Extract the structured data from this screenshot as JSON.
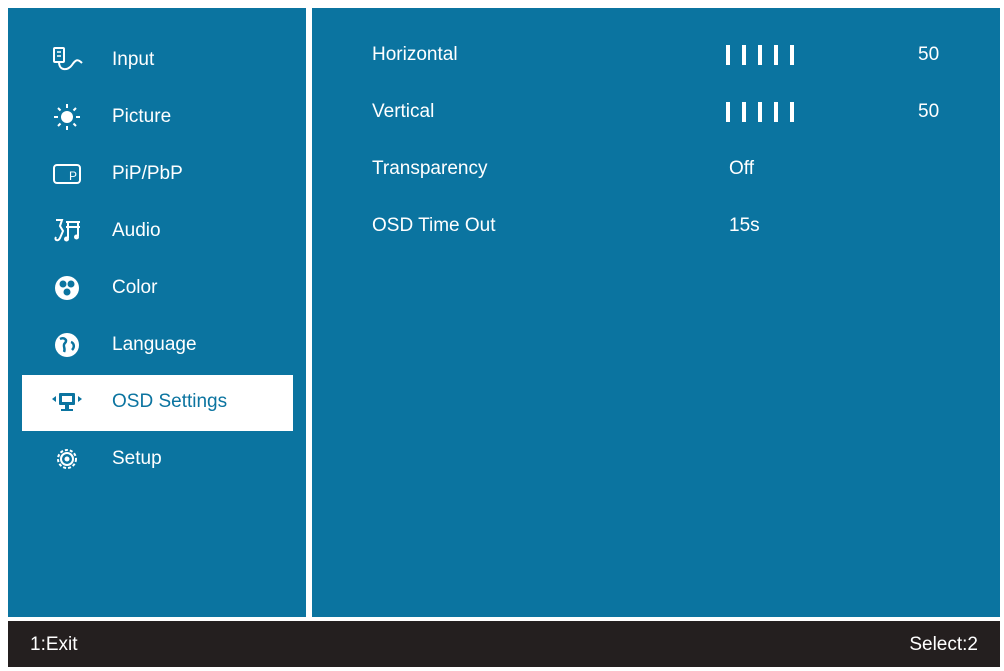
{
  "sidebar": {
    "items": [
      {
        "label": "Input",
        "icon": "input-icon"
      },
      {
        "label": "Picture",
        "icon": "brightness-icon"
      },
      {
        "label": "PiP/PbP",
        "icon": "pip-icon"
      },
      {
        "label": "Audio",
        "icon": "audio-icon"
      },
      {
        "label": "Color",
        "icon": "color-icon"
      },
      {
        "label": "Language",
        "icon": "globe-icon"
      },
      {
        "label": "OSD Settings",
        "icon": "osd-icon"
      },
      {
        "label": "Setup",
        "icon": "gear-icon"
      }
    ],
    "selected_index": 6
  },
  "settings": {
    "horizontal": {
      "label": "Horizontal",
      "value": "50"
    },
    "vertical": {
      "label": "Vertical",
      "value": "50"
    },
    "transparency": {
      "label": "Transparency",
      "value": "Off"
    },
    "osd_timeout": {
      "label": "OSD Time Out",
      "value": "15s"
    }
  },
  "footer": {
    "exit": "1:Exit",
    "select": "Select:2"
  },
  "colors": {
    "panel": "#0b74a0",
    "footer": "#241f1f",
    "highlight": "#ffffff"
  }
}
